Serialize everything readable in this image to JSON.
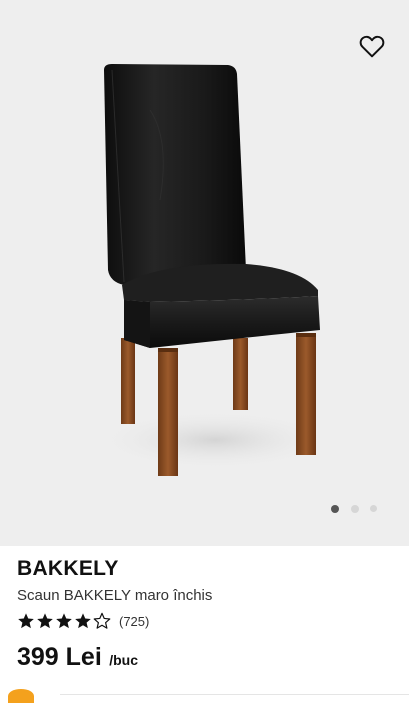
{
  "product": {
    "name": "BAKKELY",
    "description": "Scaun BAKKELY maro închis",
    "rating": {
      "stars": 4,
      "max": 5,
      "count_label": "(725)"
    },
    "price": {
      "amount": "399 Lei",
      "unit": "/buc"
    }
  },
  "gallery": {
    "current_index": 1,
    "total_images": 3
  },
  "icons": {
    "favorite": "heart-outline-icon",
    "rating": "star-icon"
  },
  "colors": {
    "background": "#eeeeee",
    "star": "#111111",
    "dot_active": "#555555",
    "dot_inactive": "#d6d6d6"
  }
}
